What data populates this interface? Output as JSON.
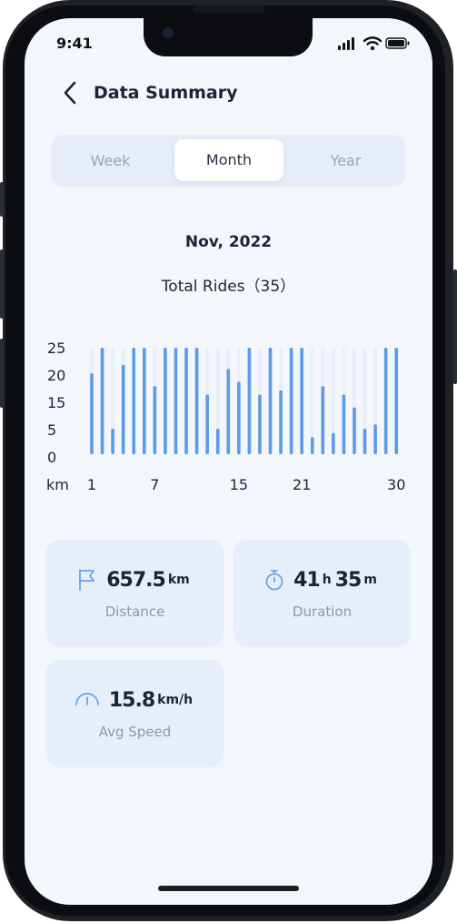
{
  "status_bar": {
    "time": "9:41"
  },
  "header": {
    "title": "Data Summary",
    "back_icon": "chevron-left-icon"
  },
  "segments": [
    {
      "label": "Week",
      "active": false
    },
    {
      "label": "Month",
      "active": true
    },
    {
      "label": "Year",
      "active": false
    }
  ],
  "summary": {
    "period": "Nov, 2022",
    "total_rides_label": "Total Rides（35）"
  },
  "chart_data": {
    "type": "bar",
    "y_ticks": [
      "25",
      "20",
      "15",
      "5",
      "0"
    ],
    "x_tick_labels": [
      "km",
      "1",
      "7",
      "15",
      "21",
      "30"
    ],
    "x": [
      1,
      2,
      3,
      4,
      5,
      6,
      7,
      8,
      9,
      10,
      11,
      12,
      13,
      14,
      15,
      16,
      17,
      18,
      19,
      20,
      21,
      22,
      23,
      24,
      25,
      26,
      27,
      28,
      29,
      30
    ],
    "values": [
      19,
      25,
      6,
      21,
      25,
      25,
      16,
      25,
      25,
      25,
      25,
      14,
      6,
      20,
      17,
      25,
      14,
      25,
      15,
      25,
      25,
      4,
      16,
      5,
      14,
      11,
      6,
      7,
      25,
      25
    ],
    "bar_color": "#5b9be8",
    "track_color": "#e9eff9"
  },
  "stats": {
    "distance": {
      "value": "657.5",
      "unit": "km",
      "label": "Distance",
      "icon": "flag-icon"
    },
    "duration": {
      "hours": "41",
      "hours_unit": "h",
      "minutes": "35",
      "minutes_unit": "m",
      "label": "Duration",
      "icon": "stopwatch-icon"
    },
    "avg_speed": {
      "value": "15.8",
      "unit": "km/h",
      "label": "Avg Speed",
      "icon": "speedometer-icon"
    }
  },
  "colors": {
    "accent": "#5b9be8",
    "background": "#f3f6fb",
    "card": "#e6eef9"
  }
}
